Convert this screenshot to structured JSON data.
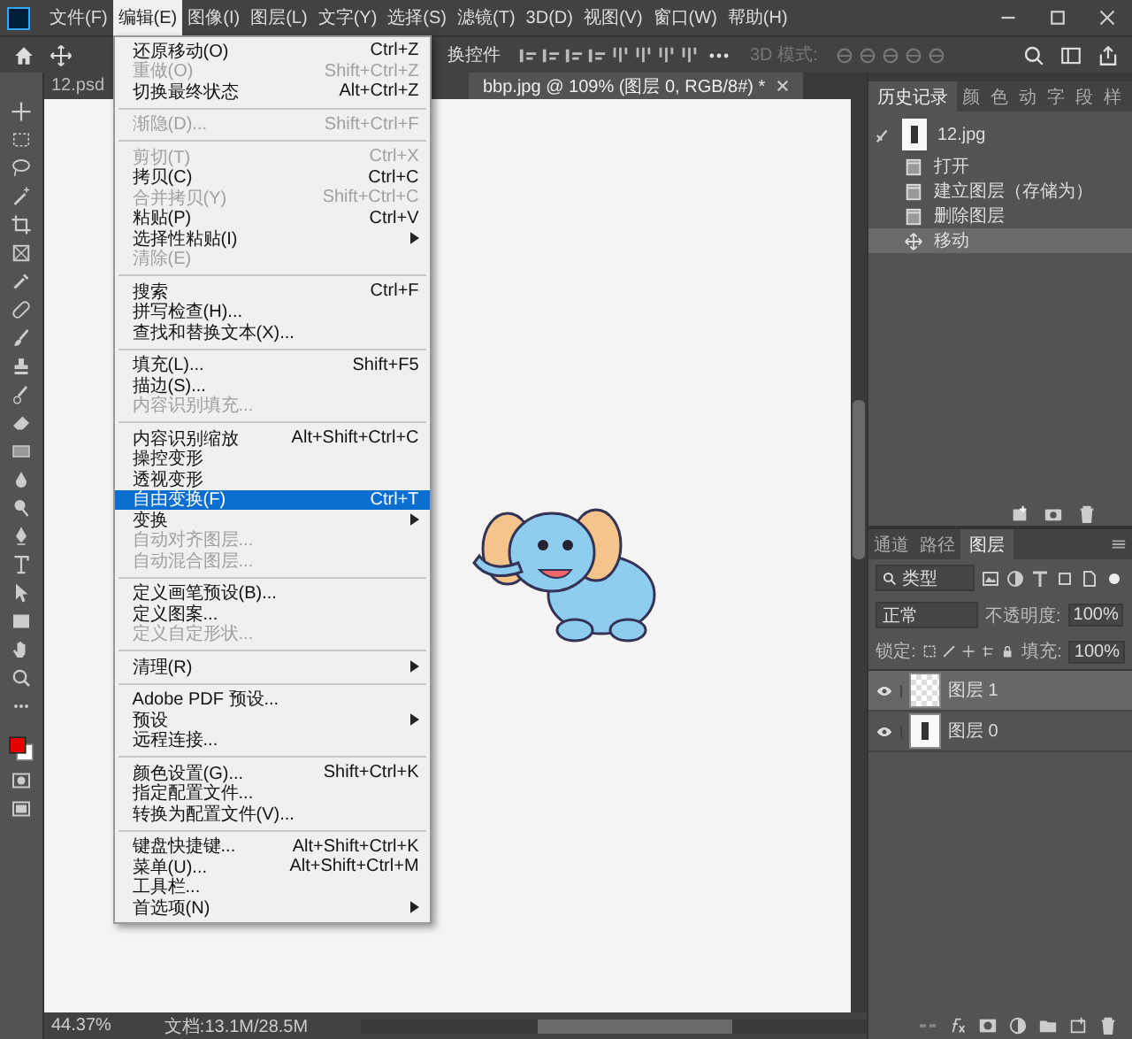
{
  "menu_bar": {
    "items": [
      {
        "label": "文件(F)",
        "selected": false
      },
      {
        "label": "编辑(E)",
        "selected": true
      },
      {
        "label": "图像(I)",
        "selected": false
      },
      {
        "label": "图层(L)",
        "selected": false
      },
      {
        "label": "文字(Y)",
        "selected": false
      },
      {
        "label": "选择(S)",
        "selected": false
      },
      {
        "label": "滤镜(T)",
        "selected": false
      },
      {
        "label": "3D(D)",
        "selected": false
      },
      {
        "label": "视图(V)",
        "selected": false
      },
      {
        "label": "窗口(W)",
        "selected": false
      },
      {
        "label": "帮助(H)",
        "selected": false
      }
    ]
  },
  "options_bar": {
    "transform_label": "换控件",
    "mode_label": "3D 模式:"
  },
  "document_tabs": [
    {
      "label": "12.psd",
      "selected": false
    },
    {
      "label": "bbp.jpg @ 109% (图层 0, RGB/8#) *",
      "selected": true
    }
  ],
  "edit_menu": {
    "groups": [
      [
        {
          "label": "还原移动(O)",
          "shortcut": "Ctrl+Z",
          "disabled": false,
          "selected": false,
          "submenu": false
        },
        {
          "label": "重做(O)",
          "shortcut": "Shift+Ctrl+Z",
          "disabled": true,
          "selected": false,
          "submenu": false
        },
        {
          "label": "切换最终状态",
          "shortcut": "Alt+Ctrl+Z",
          "disabled": false,
          "selected": false,
          "submenu": false
        }
      ],
      [
        {
          "label": "渐隐(D)...",
          "shortcut": "Shift+Ctrl+F",
          "disabled": true,
          "selected": false,
          "submenu": false
        }
      ],
      [
        {
          "label": "剪切(T)",
          "shortcut": "Ctrl+X",
          "disabled": true,
          "selected": false,
          "submenu": false
        },
        {
          "label": "拷贝(C)",
          "shortcut": "Ctrl+C",
          "disabled": false,
          "selected": false,
          "submenu": false
        },
        {
          "label": "合并拷贝(Y)",
          "shortcut": "Shift+Ctrl+C",
          "disabled": true,
          "selected": false,
          "submenu": false
        },
        {
          "label": "粘贴(P)",
          "shortcut": "Ctrl+V",
          "disabled": false,
          "selected": false,
          "submenu": false
        },
        {
          "label": "选择性粘贴(I)",
          "disabled": false,
          "selected": false,
          "submenu": true
        },
        {
          "label": "清除(E)",
          "disabled": true,
          "selected": false,
          "submenu": false
        }
      ],
      [
        {
          "label": "搜索",
          "shortcut": "Ctrl+F",
          "disabled": false,
          "selected": false,
          "submenu": false
        },
        {
          "label": "拼写检查(H)...",
          "disabled": false,
          "selected": false,
          "submenu": false
        },
        {
          "label": "查找和替换文本(X)...",
          "disabled": false,
          "selected": false,
          "submenu": false
        }
      ],
      [
        {
          "label": "填充(L)...",
          "shortcut": "Shift+F5",
          "disabled": false,
          "selected": false,
          "submenu": false
        },
        {
          "label": "描边(S)...",
          "disabled": false,
          "selected": false,
          "submenu": false
        },
        {
          "label": "内容识别填充...",
          "disabled": true,
          "selected": false,
          "submenu": false
        }
      ],
      [
        {
          "label": "内容识别缩放",
          "shortcut": "Alt+Shift+Ctrl+C",
          "disabled": false,
          "selected": false,
          "submenu": false
        },
        {
          "label": "操控变形",
          "disabled": false,
          "selected": false,
          "submenu": false
        },
        {
          "label": "透视变形",
          "disabled": false,
          "selected": false,
          "submenu": false
        },
        {
          "label": "自由变换(F)",
          "shortcut": "Ctrl+T",
          "disabled": false,
          "selected": true,
          "submenu": false
        },
        {
          "label": "变换",
          "disabled": false,
          "selected": false,
          "submenu": true
        },
        {
          "label": "自动对齐图层...",
          "disabled": true,
          "selected": false,
          "submenu": false
        },
        {
          "label": "自动混合图层...",
          "disabled": true,
          "selected": false,
          "submenu": false
        }
      ],
      [
        {
          "label": "定义画笔预设(B)...",
          "disabled": false,
          "selected": false,
          "submenu": false
        },
        {
          "label": "定义图案...",
          "disabled": false,
          "selected": false,
          "submenu": false
        },
        {
          "label": "定义自定形状...",
          "disabled": true,
          "selected": false,
          "submenu": false
        }
      ],
      [
        {
          "label": "清理(R)",
          "disabled": false,
          "selected": false,
          "submenu": true
        }
      ],
      [
        {
          "label": "Adobe PDF 预设...",
          "disabled": false,
          "selected": false,
          "submenu": false
        },
        {
          "label": "预设",
          "disabled": false,
          "selected": false,
          "submenu": true
        },
        {
          "label": "远程连接...",
          "disabled": false,
          "selected": false,
          "submenu": false
        }
      ],
      [
        {
          "label": "颜色设置(G)...",
          "shortcut": "Shift+Ctrl+K",
          "disabled": false,
          "selected": false,
          "submenu": false
        },
        {
          "label": "指定配置文件...",
          "disabled": false,
          "selected": false,
          "submenu": false
        },
        {
          "label": "转换为配置文件(V)...",
          "disabled": false,
          "selected": false,
          "submenu": false
        }
      ],
      [
        {
          "label": "键盘快捷键...",
          "shortcut": "Alt+Shift+Ctrl+K",
          "disabled": false,
          "selected": false,
          "submenu": false
        },
        {
          "label": "菜单(U)...",
          "shortcut": "Alt+Shift+Ctrl+M",
          "disabled": false,
          "selected": false,
          "submenu": false
        },
        {
          "label": "工具栏...",
          "disabled": false,
          "selected": false,
          "submenu": false
        },
        {
          "label": "首选项(N)",
          "disabled": false,
          "selected": false,
          "submenu": true
        }
      ]
    ]
  },
  "history_panel": {
    "tabs": [
      {
        "label": "历史记录",
        "selected": true
      },
      {
        "label": "颜",
        "selected": false
      },
      {
        "label": "色",
        "selected": false
      },
      {
        "label": "动",
        "selected": false
      },
      {
        "label": "字",
        "selected": false
      },
      {
        "label": "段",
        "selected": false
      },
      {
        "label": "样",
        "selected": false
      }
    ],
    "snapshot": {
      "label": "12.jpg"
    },
    "items": [
      {
        "label": "打开",
        "kind": "document",
        "selected": false
      },
      {
        "label": "建立图层（存储为）",
        "kind": "document",
        "selected": false
      },
      {
        "label": "删除图层",
        "kind": "document",
        "selected": false
      },
      {
        "label": "移动",
        "kind": "move",
        "selected": true
      }
    ]
  },
  "layers_panel": {
    "tabs": [
      {
        "label": "通道",
        "selected": false
      },
      {
        "label": "路径",
        "selected": false
      },
      {
        "label": "图层",
        "selected": true
      }
    ],
    "filter": "类型",
    "blend_mode": "正常",
    "opacity_label": "不透明度:",
    "opacity": "100%",
    "lock_label": "锁定:",
    "fill_label": "填充:",
    "fill": "100%",
    "layers": [
      {
        "name": "图层 1",
        "kind": "transparent",
        "visible": true,
        "selected": true
      },
      {
        "name": "图层 0",
        "kind": "photo",
        "visible": true,
        "selected": false
      }
    ]
  },
  "status_bar": {
    "zoom": "44.37%",
    "doc_info": "文档:13.1M/28.5M"
  }
}
